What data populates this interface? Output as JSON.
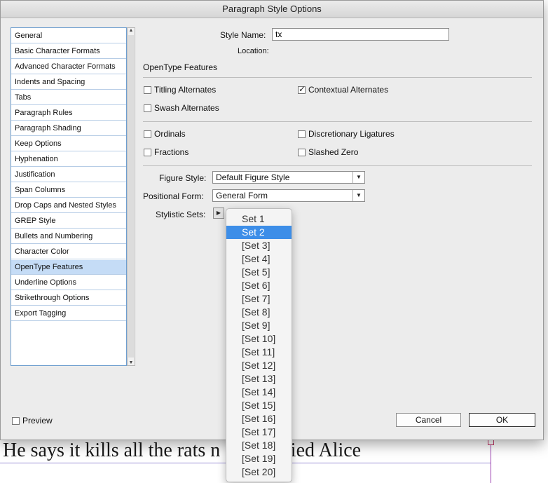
{
  "document": {
    "line_text": "He says it kills all the rats    n dear!’ cried Alice"
  },
  "dialog": {
    "title": "Paragraph Style Options"
  },
  "sidebar": {
    "items": [
      {
        "label": "General"
      },
      {
        "label": "Basic Character Formats"
      },
      {
        "label": "Advanced Character Formats"
      },
      {
        "label": "Indents and Spacing"
      },
      {
        "label": "Tabs"
      },
      {
        "label": "Paragraph Rules"
      },
      {
        "label": "Paragraph Shading"
      },
      {
        "label": "Keep Options"
      },
      {
        "label": "Hyphenation"
      },
      {
        "label": "Justification"
      },
      {
        "label": "Span Columns"
      },
      {
        "label": "Drop Caps and Nested Styles"
      },
      {
        "label": "GREP Style"
      },
      {
        "label": "Bullets and Numbering"
      },
      {
        "label": "Character Color"
      },
      {
        "label": "OpenType Features"
      },
      {
        "label": "Underline Options"
      },
      {
        "label": "Strikethrough Options"
      },
      {
        "label": "Export Tagging"
      }
    ],
    "selected": "OpenType Features"
  },
  "main": {
    "style_name_label": "Style Name:",
    "style_name_value": "tx",
    "location_label": "Location:",
    "section_title": "OpenType Features",
    "checkboxes": {
      "titling_alternates": {
        "label": "Titling Alternates",
        "checked": false
      },
      "contextual_alternates": {
        "label": "Contextual Alternates",
        "checked": true
      },
      "swash_alternates": {
        "label": "Swash Alternates",
        "checked": false
      },
      "ordinals": {
        "label": "Ordinals",
        "checked": false
      },
      "discretionary_ligatures": {
        "label": "Discretionary Ligatures",
        "checked": false
      },
      "fractions": {
        "label": "Fractions",
        "checked": false
      },
      "slashed_zero": {
        "label": "Slashed Zero",
        "checked": false
      }
    },
    "figure_style_label": "Figure Style:",
    "figure_style_value": "Default Figure Style",
    "positional_form_label": "Positional Form:",
    "positional_form_value": "General Form",
    "stylistic_sets_label": "Stylistic Sets:"
  },
  "popup": {
    "items": [
      "Set 1",
      "Set 2",
      "[Set 3]",
      "[Set 4]",
      "[Set 5]",
      "[Set 6]",
      "[Set 7]",
      "[Set 8]",
      "[Set 9]",
      "[Set 10]",
      "[Set 11]",
      "[Set 12]",
      "[Set 13]",
      "[Set 14]",
      "[Set 15]",
      "[Set 16]",
      "[Set 17]",
      "[Set 18]",
      "[Set 19]",
      "[Set 20]"
    ],
    "highlighted": "Set 2"
  },
  "footer": {
    "preview_label": "Preview",
    "preview_checked": false,
    "cancel_label": "Cancel",
    "ok_label": "OK"
  },
  "icons": {
    "dropdown": "chevron-down-icon",
    "submenu": "triangle-right-icon",
    "check": "checkmark-icon"
  },
  "colors": {
    "selection": "#c5dcf6",
    "menu_highlight": "#3d8ee8",
    "list_border": "#6e9ecf"
  }
}
